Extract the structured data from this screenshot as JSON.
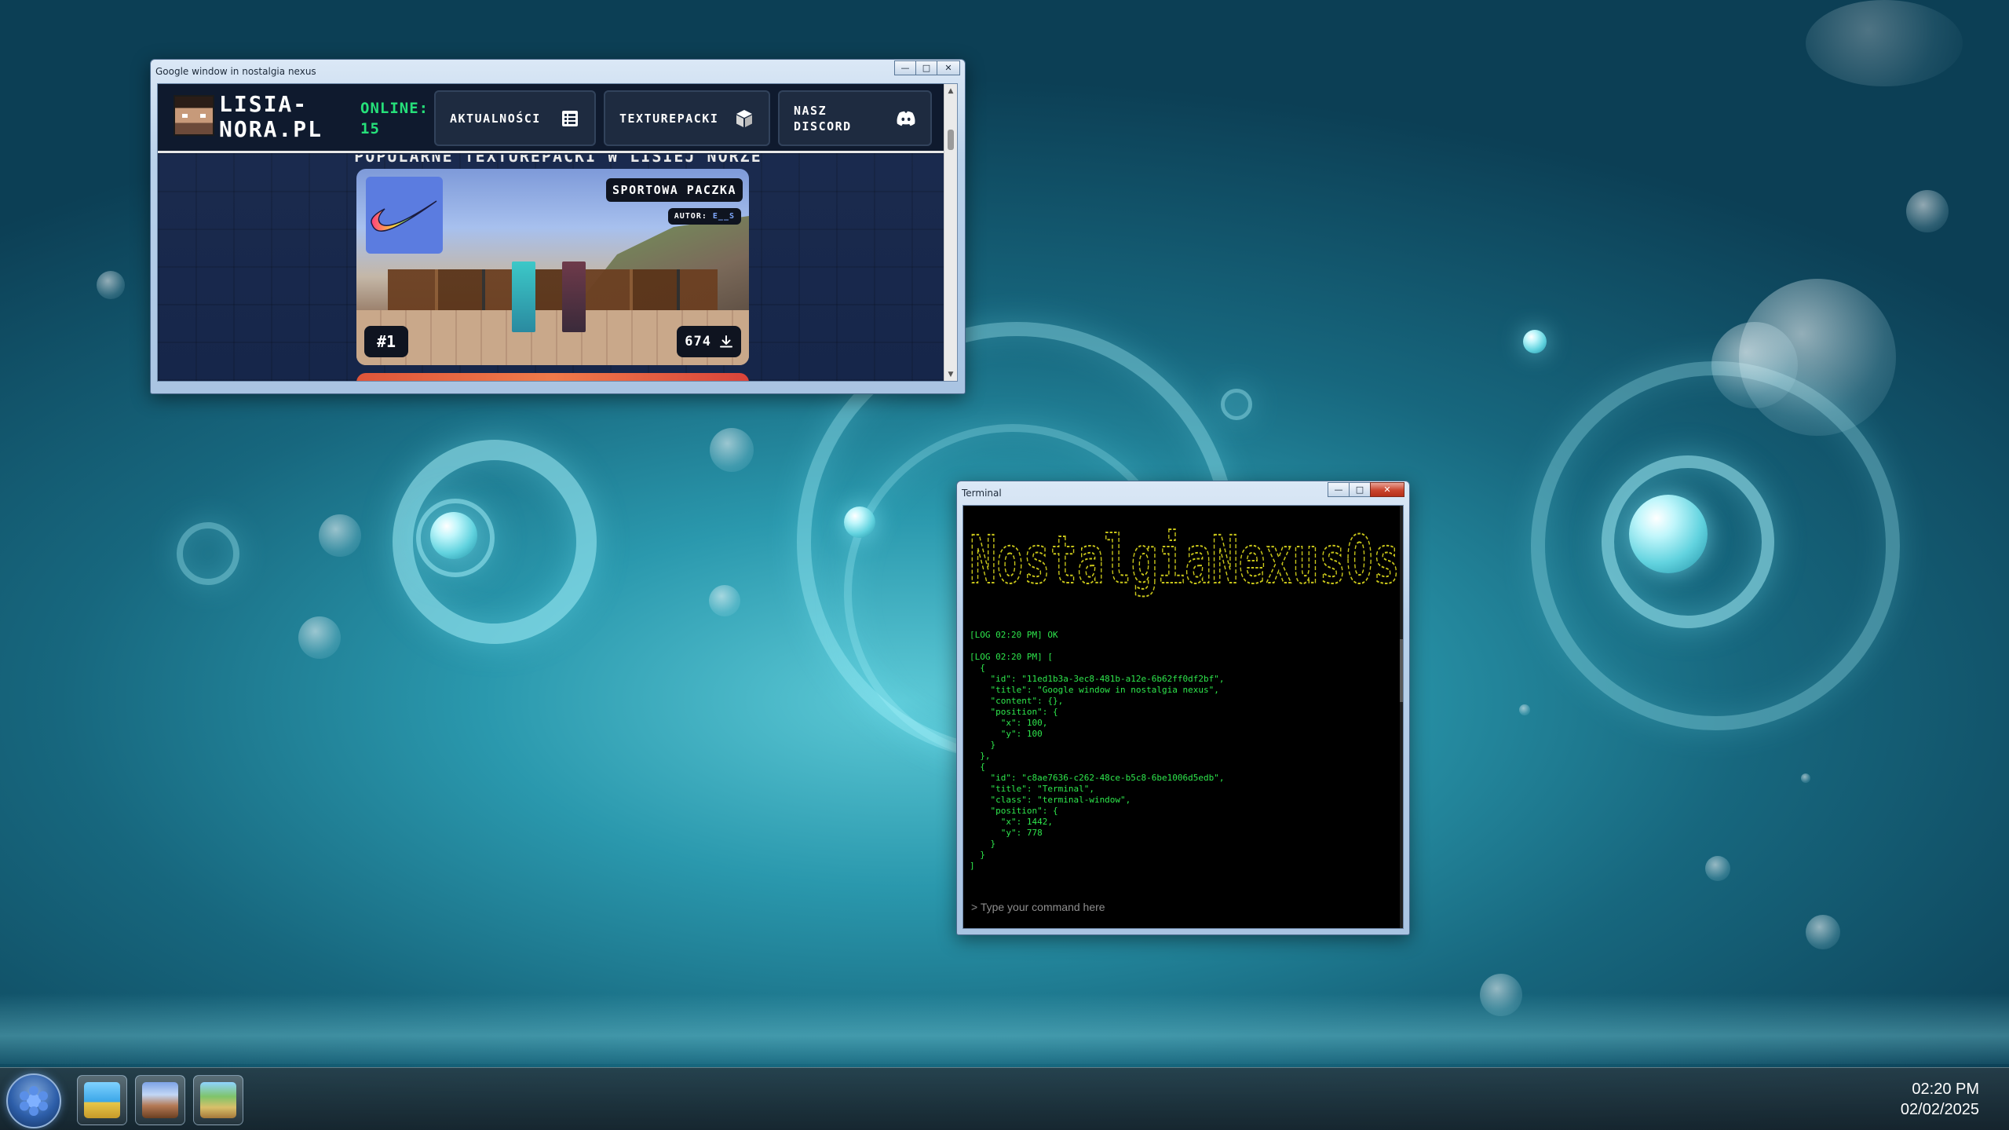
{
  "browser_window": {
    "title": "Google window in nostalgia nexus",
    "controls": {
      "minimize": "—",
      "maximize": "□",
      "close": "✕"
    },
    "site": {
      "logo_text": "LISIA-\nNORA.PL",
      "online_label": "ONLINE:",
      "online_count": "15",
      "nav": {
        "news": "AKTUALNOŚCI",
        "texturepacks": "TEXTUREPACKI",
        "discord": "NASZ\nDISCORD"
      },
      "section_heading_partial": "POPULARNE TEXTUREPACKI W LISIEJ NORZE",
      "pack": {
        "name": "SPORTOWA PACZKA",
        "author_label": "AUTOR:",
        "author": "E__S",
        "rank": "#1",
        "downloads": "674"
      }
    }
  },
  "terminal_window": {
    "title": "Terminal",
    "banner": "NostalgiaNexusOs",
    "log_text": "[LOG 02:20 PM] OK\n\n[LOG 02:20 PM] [\n  {\n    \"id\": \"11ed1b3a-3ec8-481b-a12e-6b62ff0df2bf\",\n    \"title\": \"Google window in nostalgia nexus\",\n    \"content\": {},\n    \"position\": {\n      \"x\": 100,\n      \"y\": 100\n    }\n  },\n  {\n    \"id\": \"c8ae7636-c262-48ce-b5c8-6be1006d5edb\",\n    \"title\": \"Terminal\",\n    \"class\": \"terminal-window\",\n    \"position\": {\n      \"x\": 1442,\n      \"y\": 778\n    }\n  }\n]",
    "input_placeholder": "> Type your command here"
  },
  "taskbar": {
    "apps": [
      "start-menu",
      "file-explorer-app",
      "game-app-1",
      "game-app-2"
    ],
    "time": "02:20 PM",
    "date": "02/02/2025"
  },
  "colors": {
    "terminal_text": "#2ee64c",
    "online_green": "#26e07a",
    "banner_yellow": "#c9c61a"
  }
}
